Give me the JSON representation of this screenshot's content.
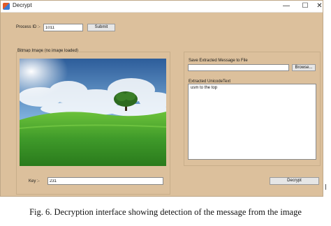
{
  "window": {
    "title": "Decrypt",
    "controls": {
      "minimize": "—",
      "maximize": "☐",
      "close": "✕"
    }
  },
  "process": {
    "label": "Process ID :-",
    "value": "1011",
    "submit_label": "Submit"
  },
  "bitmap_group": {
    "label": "Bitmap Image (no image loaded)"
  },
  "save_group": {
    "label": "Save Extracted Message to File",
    "path_value": "",
    "browse_label": "Browse..."
  },
  "unicode": {
    "label": "Extracted UnicodeText",
    "text": "usm to the top"
  },
  "key": {
    "label": "Key :-",
    "value": "231"
  },
  "decrypt_label": "Decrypt",
  "caption": "Fig. 6. Decryption interface showing detection of the message from the image",
  "colors": {
    "window_bg": "#dcc09c",
    "sky": "#4f86c6",
    "grass": "#3f9a2a"
  }
}
